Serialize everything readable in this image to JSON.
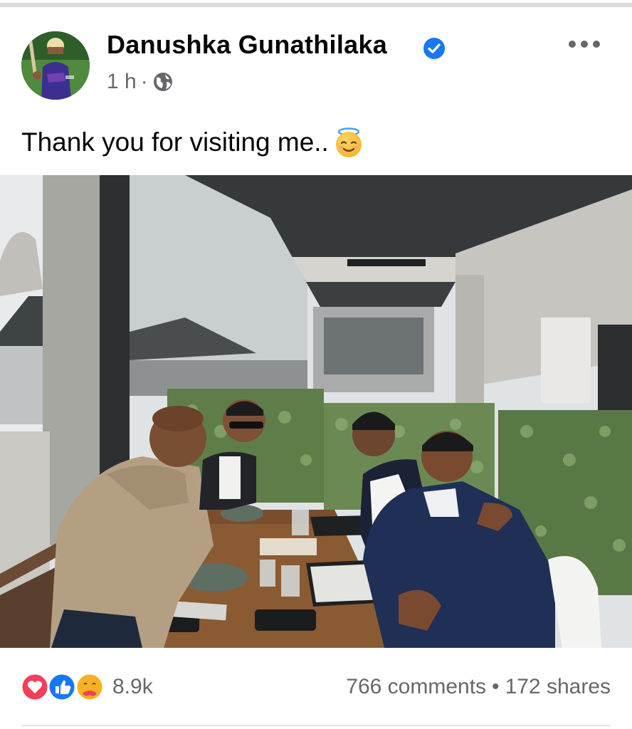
{
  "post": {
    "author_name": "Danushka Gunathilaka",
    "time": "1 h",
    "separator": "·",
    "caption": "Thank you for visiting me..",
    "icons": {
      "verified": "verified-badge-icon",
      "privacy": "globe-icon",
      "more": "more-options-icon",
      "caption_emoji": "smiling-face-with-halo-emoji"
    },
    "photo_description_icon": "restaurant-photo"
  },
  "engagement": {
    "reaction_icons": [
      "love-reaction-icon",
      "like-reaction-icon",
      "care-reaction-icon"
    ],
    "reaction_count": "8.9k",
    "comments": "766 comments",
    "dot": "•",
    "shares": "172 shares"
  },
  "colors": {
    "verified_blue": "#1877f2",
    "meta_gray": "#65676b",
    "love_red": "#f33e58",
    "like_blue": "#1877f2",
    "care_yellow": "#f7b125"
  }
}
